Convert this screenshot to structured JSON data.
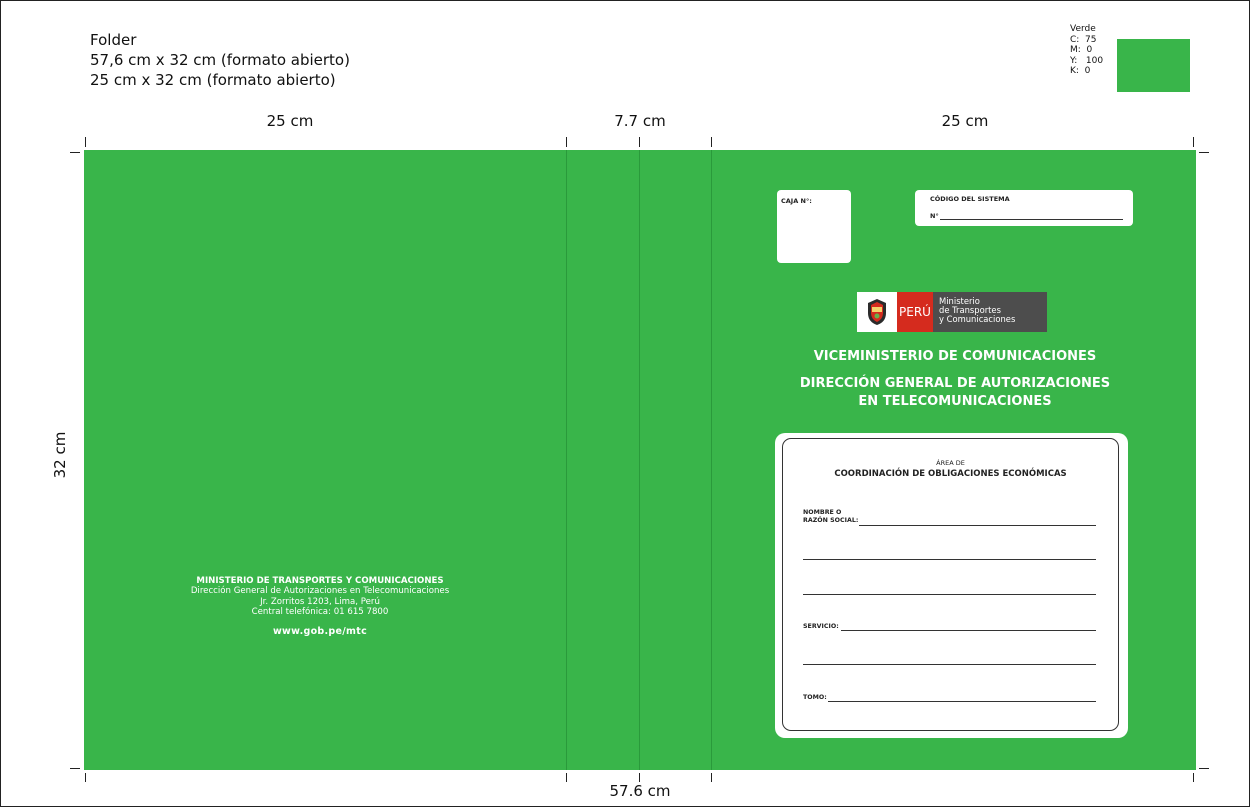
{
  "header": {
    "title": "Folder",
    "format_open": "57,6 cm x 32 cm (formato abierto)",
    "format_closed": "25 cm x 32 cm (formato abierto)"
  },
  "color_swatch": {
    "name": "Verde",
    "c": "C:  75",
    "m": "M:  0",
    "y": "Y:   100",
    "k": "K:  0",
    "hex": "#39b54a"
  },
  "measurements": {
    "left_width": "25 cm",
    "spine_width": "7.7 cm",
    "right_width": "25 cm",
    "height": "32 cm",
    "total_width": "57.6 cm"
  },
  "back_cover": {
    "ministry": "MINISTERIO DE TRANSPORTES Y COMUNICACIONES",
    "direction": "Dirección General de Autorizaciones en Telecomunicaciones",
    "address": "Jr. Zorritos 1203, Lima, Perú",
    "phone": "Central telefónica: 01 615 7800",
    "url": "www.gob.pe/mtc"
  },
  "front_cover": {
    "caja_label": "CAJA N°:",
    "codigo_label": "CÓDIGO DEL SISTEMA",
    "codigo_num": "N°",
    "logo": {
      "peru": "PERÚ",
      "line1": "Ministerio",
      "line2": "de Transportes",
      "line3": "y Comunicaciones"
    },
    "heading1": "VICEMINISTERIO DE COMUNICACIONES",
    "heading2_line1": "DIRECCIÓN GENERAL DE AUTORIZACIONES",
    "heading2_line2": "EN TELECOMUNICACIONES",
    "form": {
      "area_small": "ÁREA DE",
      "area_title": "COORDINACIÓN DE OBLIGACIONES ECONÓMICAS",
      "nombre_line1": "NOMBRE O",
      "nombre_line2": "RAZÓN SOCIAL:",
      "servicio": "SERVICIO:",
      "tomo": "TOMO:"
    }
  }
}
